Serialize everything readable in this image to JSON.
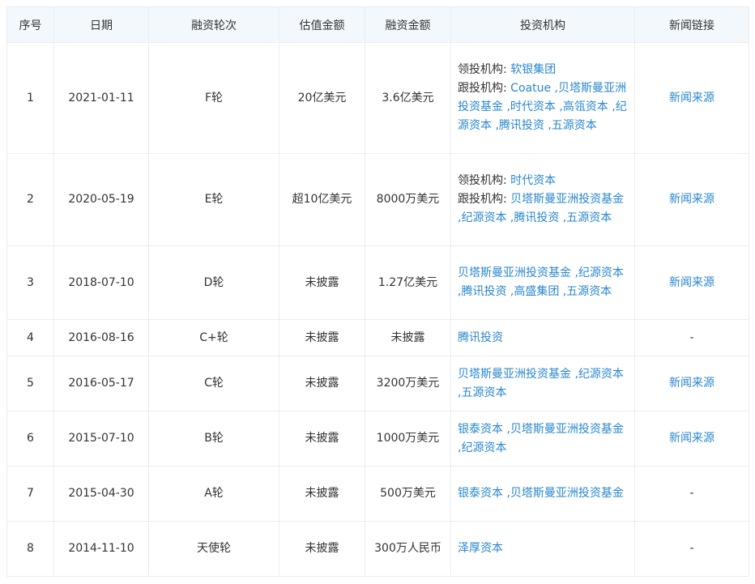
{
  "headers": {
    "index": "序号",
    "date": "日期",
    "round": "融资轮次",
    "valuation": "估值金额",
    "amount": "融资金额",
    "investors": "投资机构",
    "news": "新闻链接"
  },
  "labels": {
    "lead": "领投机构: ",
    "follow": "跟投机构: "
  },
  "rows": [
    {
      "index": "1",
      "date": "2021-01-11",
      "round": "F轮",
      "valuation": "20亿美元",
      "amount": "3.6亿美元",
      "lead": [
        "软银集团"
      ],
      "follow": [
        "Coatue",
        "贝塔斯曼亚洲投资基金",
        "时代资本",
        "高瓴资本",
        "纪源资本",
        "腾讯投资",
        "五源资本"
      ],
      "investors": [],
      "news": "新闻来源"
    },
    {
      "index": "2",
      "date": "2020-05-19",
      "round": "E轮",
      "valuation": "超10亿美元",
      "amount": "8000万美元",
      "lead": [
        "时代资本"
      ],
      "follow": [
        "贝塔斯曼亚洲投资基金",
        "纪源资本",
        "腾讯投资",
        "五源资本"
      ],
      "investors": [],
      "news": "新闻来源"
    },
    {
      "index": "3",
      "date": "2018-07-10",
      "round": "D轮",
      "valuation": "未披露",
      "amount": "1.27亿美元",
      "lead": [],
      "follow": [],
      "investors": [
        "贝塔斯曼亚洲投资基金",
        "纪源资本",
        "腾讯投资",
        "高盛集团",
        "五源资本"
      ],
      "news": "新闻来源"
    },
    {
      "index": "4",
      "date": "2016-08-16",
      "round": "C+轮",
      "valuation": "未披露",
      "amount": "未披露",
      "lead": [],
      "follow": [],
      "investors": [
        "腾讯投资"
      ],
      "news": "-"
    },
    {
      "index": "5",
      "date": "2016-05-17",
      "round": "C轮",
      "valuation": "未披露",
      "amount": "3200万美元",
      "lead": [],
      "follow": [],
      "investors": [
        "贝塔斯曼亚洲投资基金",
        "纪源资本",
        "五源资本"
      ],
      "news": "新闻来源"
    },
    {
      "index": "6",
      "date": "2015-07-10",
      "round": "B轮",
      "valuation": "未披露",
      "amount": "1000万美元",
      "lead": [],
      "follow": [],
      "investors": [
        "银泰资本",
        "贝塔斯曼亚洲投资基金",
        "纪源资本"
      ],
      "news": "新闻来源"
    },
    {
      "index": "7",
      "date": "2015-04-30",
      "round": "A轮",
      "valuation": "未披露",
      "amount": "500万美元",
      "lead": [],
      "follow": [],
      "investors": [
        "银泰资本",
        "贝塔斯曼亚洲投资基金"
      ],
      "news": "-"
    },
    {
      "index": "8",
      "date": "2014-11-10",
      "round": "天使轮",
      "valuation": "未披露",
      "amount": "300万人民币",
      "lead": [],
      "follow": [],
      "investors": [
        "泽厚资本"
      ],
      "news": "-"
    }
  ],
  "colors": {
    "link": "#2a87cf",
    "header_bg": "#f3f8fc",
    "border": "#e8eef3",
    "text": "#333333"
  }
}
